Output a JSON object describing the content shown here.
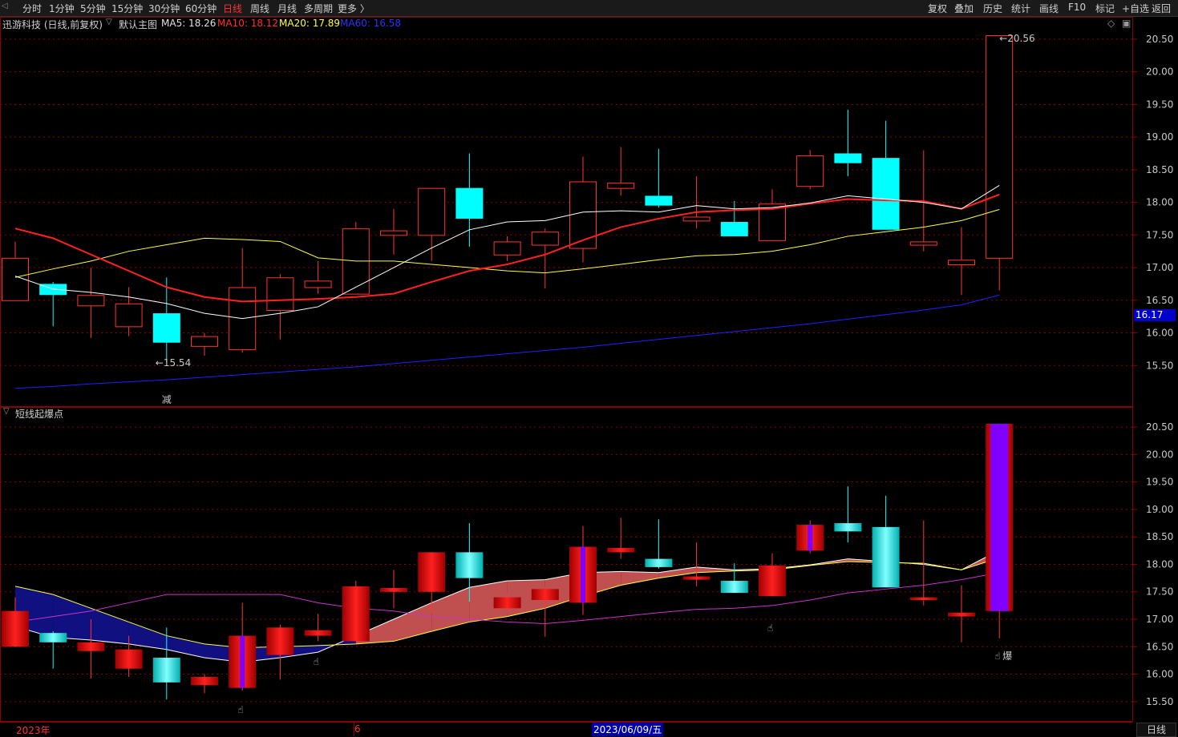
{
  "toolbar": {
    "back_icon": "back-arrow-icon",
    "periods": [
      "分时",
      "1分钟",
      "5分钟",
      "15分钟",
      "30分钟",
      "60分钟",
      "日线",
      "周线",
      "月线",
      "多周期",
      "更多 〉"
    ],
    "active_period": "日线",
    "right_items": [
      "复权",
      "叠加",
      "历史",
      "统计",
      "画线",
      "F10",
      "标记",
      "+自选",
      "返回"
    ]
  },
  "main_panel": {
    "stock": "迅游科技 (日线,前复权)",
    "template": "默认主图",
    "ma5": "MA5: 18.26",
    "ma10": "MA10: 18.12",
    "ma20": "MA20: 17.89",
    "ma60": "MA60: 16.58",
    "high_label": "20.56",
    "low_label": "15.54",
    "current_price": "16.17",
    "reduce_marker": "减",
    "y_ticks": [
      "20.50",
      "20.00",
      "19.50",
      "19.00",
      "18.50",
      "18.00",
      "17.50",
      "17.00",
      "16.50",
      "16.00",
      "15.50"
    ]
  },
  "sub_panel": {
    "indicator": "短线起爆点",
    "explode_marker": "爆",
    "y_ticks": [
      "20.50",
      "20.00",
      "19.50",
      "19.00",
      "18.50",
      "18.00",
      "17.50",
      "17.00",
      "16.50",
      "16.00",
      "15.50"
    ]
  },
  "x_axis": {
    "year_label": "2023年",
    "month_label": "6",
    "cursor_date": "2023/06/09/五",
    "period_tab": "日线"
  },
  "colors": {
    "up": "#ff3333",
    "down": "#00ffff",
    "ma5": "#ffffff",
    "ma10": "#ff2020",
    "ma20": "#ffff40",
    "ma60": "#2020ff",
    "grid": "#8b0000"
  },
  "chart_data": {
    "type": "candlestick",
    "candles": [
      {
        "o": 16.5,
        "h": 17.4,
        "l": 16.5,
        "c": 17.15
      },
      {
        "o": 16.75,
        "h": 16.78,
        "l": 16.1,
        "c": 16.58
      },
      {
        "o": 16.42,
        "h": 17.0,
        "l": 15.92,
        "c": 16.58
      },
      {
        "o": 16.1,
        "h": 16.7,
        "l": 15.95,
        "c": 16.45
      },
      {
        "o": 16.3,
        "h": 16.85,
        "l": 15.54,
        "c": 15.85
      },
      {
        "o": 15.8,
        "h": 16.0,
        "l": 15.65,
        "c": 15.95
      },
      {
        "o": 15.75,
        "h": 17.3,
        "l": 15.7,
        "c": 16.7
      },
      {
        "o": 16.35,
        "h": 16.9,
        "l": 15.9,
        "c": 16.85
      },
      {
        "o": 16.7,
        "h": 17.1,
        "l": 16.6,
        "c": 16.8
      },
      {
        "o": 16.6,
        "h": 17.7,
        "l": 16.6,
        "c": 17.6
      },
      {
        "o": 17.5,
        "h": 17.9,
        "l": 17.2,
        "c": 17.57
      },
      {
        "o": 17.5,
        "h": 18.2,
        "l": 17.1,
        "c": 18.22
      },
      {
        "o": 18.22,
        "h": 18.75,
        "l": 17.32,
        "c": 17.75
      },
      {
        "o": 17.2,
        "h": 17.48,
        "l": 17.1,
        "c": 17.4
      },
      {
        "o": 17.35,
        "h": 17.6,
        "l": 16.68,
        "c": 17.55
      },
      {
        "o": 17.3,
        "h": 18.7,
        "l": 17.08,
        "c": 18.32
      },
      {
        "o": 18.22,
        "h": 18.85,
        "l": 18.1,
        "c": 18.3
      },
      {
        "o": 18.1,
        "h": 18.82,
        "l": 17.92,
        "c": 17.95
      },
      {
        "o": 17.72,
        "h": 18.4,
        "l": 17.6,
        "c": 17.78
      },
      {
        "o": 17.7,
        "h": 18.02,
        "l": 17.5,
        "c": 17.48
      },
      {
        "o": 17.42,
        "h": 18.2,
        "l": 17.42,
        "c": 17.98
      },
      {
        "o": 18.25,
        "h": 18.8,
        "l": 18.2,
        "c": 18.72
      },
      {
        "o": 18.75,
        "h": 19.42,
        "l": 18.4,
        "c": 18.6
      },
      {
        "o": 18.68,
        "h": 19.25,
        "l": 17.6,
        "c": 17.58
      },
      {
        "o": 17.35,
        "h": 18.8,
        "l": 17.25,
        "c": 17.4
      },
      {
        "o": 17.05,
        "h": 17.62,
        "l": 16.58,
        "c": 17.12
      },
      {
        "o": 17.15,
        "h": 20.56,
        "l": 16.65,
        "c": 20.56
      }
    ],
    "ma5": [
      16.87,
      16.67,
      16.62,
      16.55,
      16.45,
      16.3,
      16.22,
      16.3,
      16.4,
      16.7,
      17.0,
      17.3,
      17.58,
      17.7,
      17.72,
      17.85,
      17.87,
      17.85,
      17.95,
      17.9,
      17.92,
      17.99,
      18.1,
      18.05,
      18.0,
      17.9,
      18.26
    ],
    "ma10": [
      17.6,
      17.45,
      17.2,
      16.95,
      16.7,
      16.55,
      16.48,
      16.5,
      16.52,
      16.55,
      16.6,
      16.78,
      16.95,
      17.05,
      17.2,
      17.42,
      17.62,
      17.75,
      17.85,
      17.88,
      17.9,
      17.98,
      18.05,
      18.03,
      18.02,
      17.9,
      18.12
    ],
    "ma20": [
      16.85,
      16.98,
      17.1,
      17.25,
      17.35,
      17.45,
      17.43,
      17.4,
      17.15,
      17.1,
      17.1,
      17.05,
      17.0,
      16.95,
      16.92,
      16.98,
      17.05,
      17.12,
      17.18,
      17.2,
      17.25,
      17.35,
      17.48,
      17.55,
      17.62,
      17.72,
      17.89
    ],
    "ma60": [
      15.15,
      15.18,
      15.22,
      15.25,
      15.28,
      15.32,
      15.36,
      15.4,
      15.44,
      15.48,
      15.53,
      15.58,
      15.63,
      15.68,
      15.73,
      15.78,
      15.84,
      15.9,
      15.96,
      16.02,
      16.08,
      16.14,
      16.21,
      16.28,
      16.35,
      16.43,
      16.58
    ],
    "sub_ma": [
      16.95,
      17.05,
      17.15,
      17.3,
      17.45,
      17.45,
      17.45,
      17.45,
      17.3,
      17.2,
      17.15,
      17.05,
      17.0,
      16.95,
      16.92,
      16.98,
      17.05,
      17.12,
      17.18,
      17.2,
      17.25,
      17.35,
      17.48,
      17.55,
      17.62,
      17.72,
      17.85
    ],
    "ylim": [
      15.1,
      20.7
    ]
  }
}
